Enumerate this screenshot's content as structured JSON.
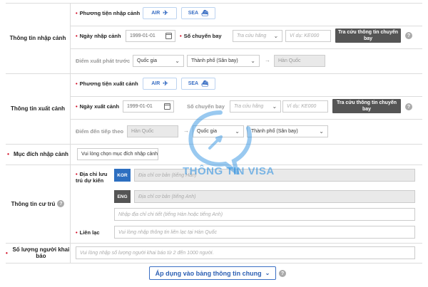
{
  "entry": {
    "section_label": "Thông tin nhập cảnh",
    "transport_label": "Phương tiện nhập cảnh",
    "air_label": "AIR",
    "sea_label": "SEA",
    "date_label": "Ngày nhập cảnh",
    "date_value": "1999-01-01",
    "flight_label": "Số chuyến bay",
    "airline_placeholder": "Tra cứu hãng",
    "flight_placeholder": "Ví dụ: KE000",
    "lookup_button": "Tra cứu thông tin chuyến bay",
    "origin_label": "Điểm xuất phát trước",
    "country_select": "Quốc gia",
    "city_select": "Thành phố (Sân bay)",
    "destination_value": "Hàn Quốc"
  },
  "exit": {
    "section_label": "Thông tin xuất cảnh",
    "transport_label": "Phương tiện xuất cảnh",
    "air_label": "AIR",
    "sea_label": "SEA",
    "date_label": "Ngày xuất cảnh",
    "date_value": "1999-01-01",
    "flight_label": "Số chuyến bay",
    "airline_placeholder": "Tra cứu hãng",
    "flight_placeholder": "Ví dụ: KE000",
    "lookup_button": "Tra cứu thông tin chuyến bay",
    "next_label": "Điểm đến tiếp theo",
    "origin_value": "Hàn Quốc",
    "country_select": "Quốc gia",
    "city_select": "Thành phố (Sân bay)"
  },
  "purpose": {
    "section_label": "Mục đích nhập cảnh",
    "select_placeholder": "Vui lòng chọn mục đích nhập cảnh"
  },
  "residence": {
    "section_label": "Thông tin cư trú",
    "address_label": "Địa chỉ lưu trú dự kiến",
    "kor_tag": "KOR",
    "eng_tag": "ENG",
    "kor_placeholder": "Địa chỉ cơ bản (tiếng Hàn)",
    "eng_placeholder": "Địa chỉ cơ bản (tiếng Anh)",
    "detail_placeholder": "Nhập địa chỉ chi tiết (tiếng Hàn hoặc tiếng Anh)",
    "contact_label": "Liên lạc",
    "contact_placeholder": "Vui lòng nhập thông tin liên lạc tại Hàn Quốc"
  },
  "count": {
    "section_label": "Số lượng người khai báo",
    "placeholder": "Vui lòng nhập số lượng người khai báo từ 2 đến 1000 người."
  },
  "apply_button": "Áp dụng vào bảng thông tin chung",
  "watermark": "THÔNG TIN VISA",
  "help_glyph": "?",
  "colors": {
    "accent": "#3a6fc4",
    "required": "#d0021b",
    "kor_tag": "#2d6fc0",
    "eng_tag": "#555555",
    "dark_button": "#555555"
  }
}
